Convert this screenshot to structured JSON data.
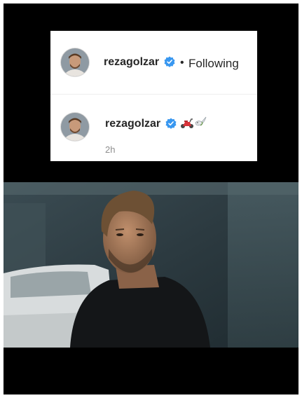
{
  "post_header": {
    "username": "rezagolzar",
    "separator": "•",
    "follow_state": "Following",
    "avatar_icon": "profile-photo",
    "verified_icon": "verified-badge-icon",
    "verified_color": "#3897f0"
  },
  "caption": {
    "username": "rezagolzar",
    "emojis": [
      "scooter-emoji",
      "dove-emoji"
    ],
    "timestamp": "2h"
  },
  "video_still": {
    "description_icon": "video-frame"
  },
  "colors": {
    "background": "#000000",
    "card": "#ffffff",
    "text_primary": "#262626",
    "text_secondary": "#8e8e8e"
  }
}
